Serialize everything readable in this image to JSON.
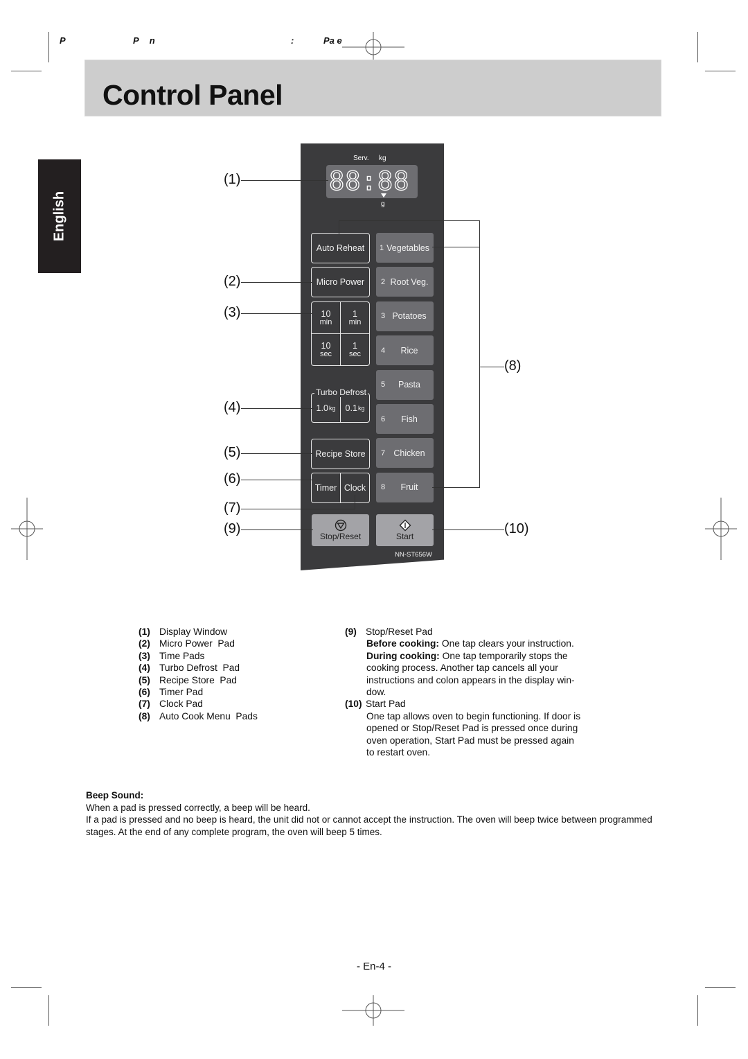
{
  "header": {
    "fragments": [
      "P",
      "P n",
      ":",
      "Pa e"
    ]
  },
  "title": "Control Panel",
  "language_tab": "English",
  "panel": {
    "display": {
      "label_serv": "Serv.",
      "label_kg": "kg",
      "label_g": "g",
      "digits": "88:88"
    },
    "left_pads": {
      "auto_reheat": "Auto Reheat",
      "micro_power": "Micro Power",
      "time": [
        {
          "value": "10",
          "unit": "min"
        },
        {
          "value": "1",
          "unit": "min"
        },
        {
          "value": "10",
          "unit": "sec"
        },
        {
          "value": "1",
          "unit": "sec"
        }
      ],
      "turbo_defrost": {
        "title": "Turbo Defrost",
        "options": [
          {
            "value": "1.0",
            "unit": "kg"
          },
          {
            "value": "0.1",
            "unit": "kg"
          }
        ]
      },
      "recipe_store": "Recipe Store",
      "timer": "Timer",
      "clock": "Clock"
    },
    "auto_cook_menu": [
      {
        "num": "1",
        "label": "Vegetables"
      },
      {
        "num": "2",
        "label": "Root Veg."
      },
      {
        "num": "3",
        "label": "Potatoes"
      },
      {
        "num": "4",
        "label": "Rice"
      },
      {
        "num": "5",
        "label": "Pasta"
      },
      {
        "num": "6",
        "label": "Fish"
      },
      {
        "num": "7",
        "label": "Chicken"
      },
      {
        "num": "8",
        "label": "Fruit"
      }
    ],
    "stop_reset": "Stop/Reset",
    "start": "Start",
    "model": "NN-ST656W"
  },
  "callouts": [
    "(1)",
    "(2)",
    "(3)",
    "(4)",
    "(5)",
    "(6)",
    "(7)",
    "(8)",
    "(9)",
    "(10)"
  ],
  "legend_left": [
    {
      "n": "(1)",
      "text": "Display Window"
    },
    {
      "n": "(2)",
      "text": "Micro Power  Pad"
    },
    {
      "n": "(3)",
      "text": "Time Pads"
    },
    {
      "n": "(4)",
      "text": "Turbo Defrost  Pad"
    },
    {
      "n": "(5)",
      "text": "Recipe Store  Pad"
    },
    {
      "n": "(6)",
      "text": "Timer Pad"
    },
    {
      "n": "(7)",
      "text": "Clock Pad"
    },
    {
      "n": "(8)",
      "text": "Auto Cook Menu  Pads"
    }
  ],
  "legend_right": {
    "stop": {
      "n": "(9)",
      "title": "Stop/Reset  Pad",
      "before_label": "Before cooking:",
      "before_text": " One tap clears your instruction.",
      "during_label": "During cooking:",
      "during_text": " One tap temporarily stops the",
      "lines": [
        "cooking process. Another tap cancels all your",
        "instructions and colon appears in the display win-",
        "dow."
      ]
    },
    "start": {
      "n": "(10)",
      "title": "Start  Pad",
      "lines": [
        "One tap allows oven to begin functioning. If door is",
        "opened or Stop/Reset  Pad is pressed once during",
        "oven operation, Start  Pad must be pressed again",
        "to restart oven."
      ]
    }
  },
  "beep": {
    "title": "Beep Sound:",
    "line1": "When a pad is pressed correctly, a beep will be heard.",
    "line2": "If a pad is pressed and no beep is heard, the unit did not or cannot accept the instruction. The oven will beep twice between programmed stages. At the end of any complete program, the oven will beep 5 times."
  },
  "page_number": "- En-4 -"
}
